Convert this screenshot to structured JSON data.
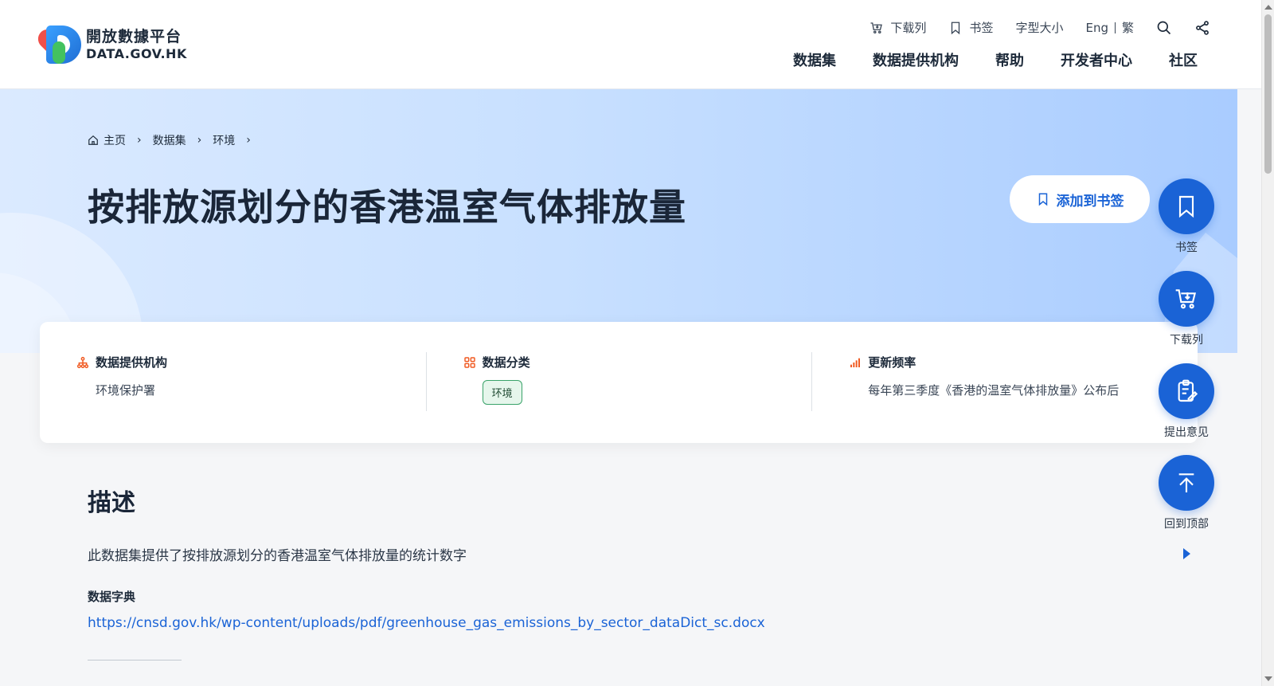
{
  "logo": {
    "title_zh": "開放數據平台",
    "title_en": "DATA.GOV.HK"
  },
  "util": {
    "download_list": "下载列",
    "bookmark": "书签",
    "font_size": "字型大小",
    "lang_en": "Eng",
    "lang_tc": "繁"
  },
  "nav": [
    {
      "label": "数据集"
    },
    {
      "label": "数据提供机构"
    },
    {
      "label": "帮助"
    },
    {
      "label": "开发者中心"
    },
    {
      "label": "社区"
    }
  ],
  "breadcrumb": {
    "home": "主页",
    "level1": "数据集",
    "level2": "环境"
  },
  "page_title": "按排放源划分的香港温室气体排放量",
  "add_bookmark": "添加到书签",
  "info": {
    "provider_label": "数据提供机构",
    "provider_value": "环境保护署",
    "category_label": "数据分类",
    "category_tag": "环境",
    "frequency_label": "更新频率",
    "frequency_value": "每年第三季度《香港的温室气体排放量》公布后"
  },
  "fabs": {
    "bookmark": "书签",
    "download": "下载列",
    "feedback": "提出意见",
    "top": "回到顶部"
  },
  "description": {
    "heading": "描述",
    "text": "此数据集提供了按排放源划分的香港温室气体排放量的统计数字",
    "dict_label": "数据字典",
    "dict_link": "https://cnsd.gov.hk/wp-content/uploads/pdf/greenhouse_gas_emissions_by_sector_dataDict_sc.docx"
  },
  "colors": {
    "accent": "#1a63d6",
    "tag_green": "#3aa36a",
    "icon_orange": "#f05a22"
  }
}
